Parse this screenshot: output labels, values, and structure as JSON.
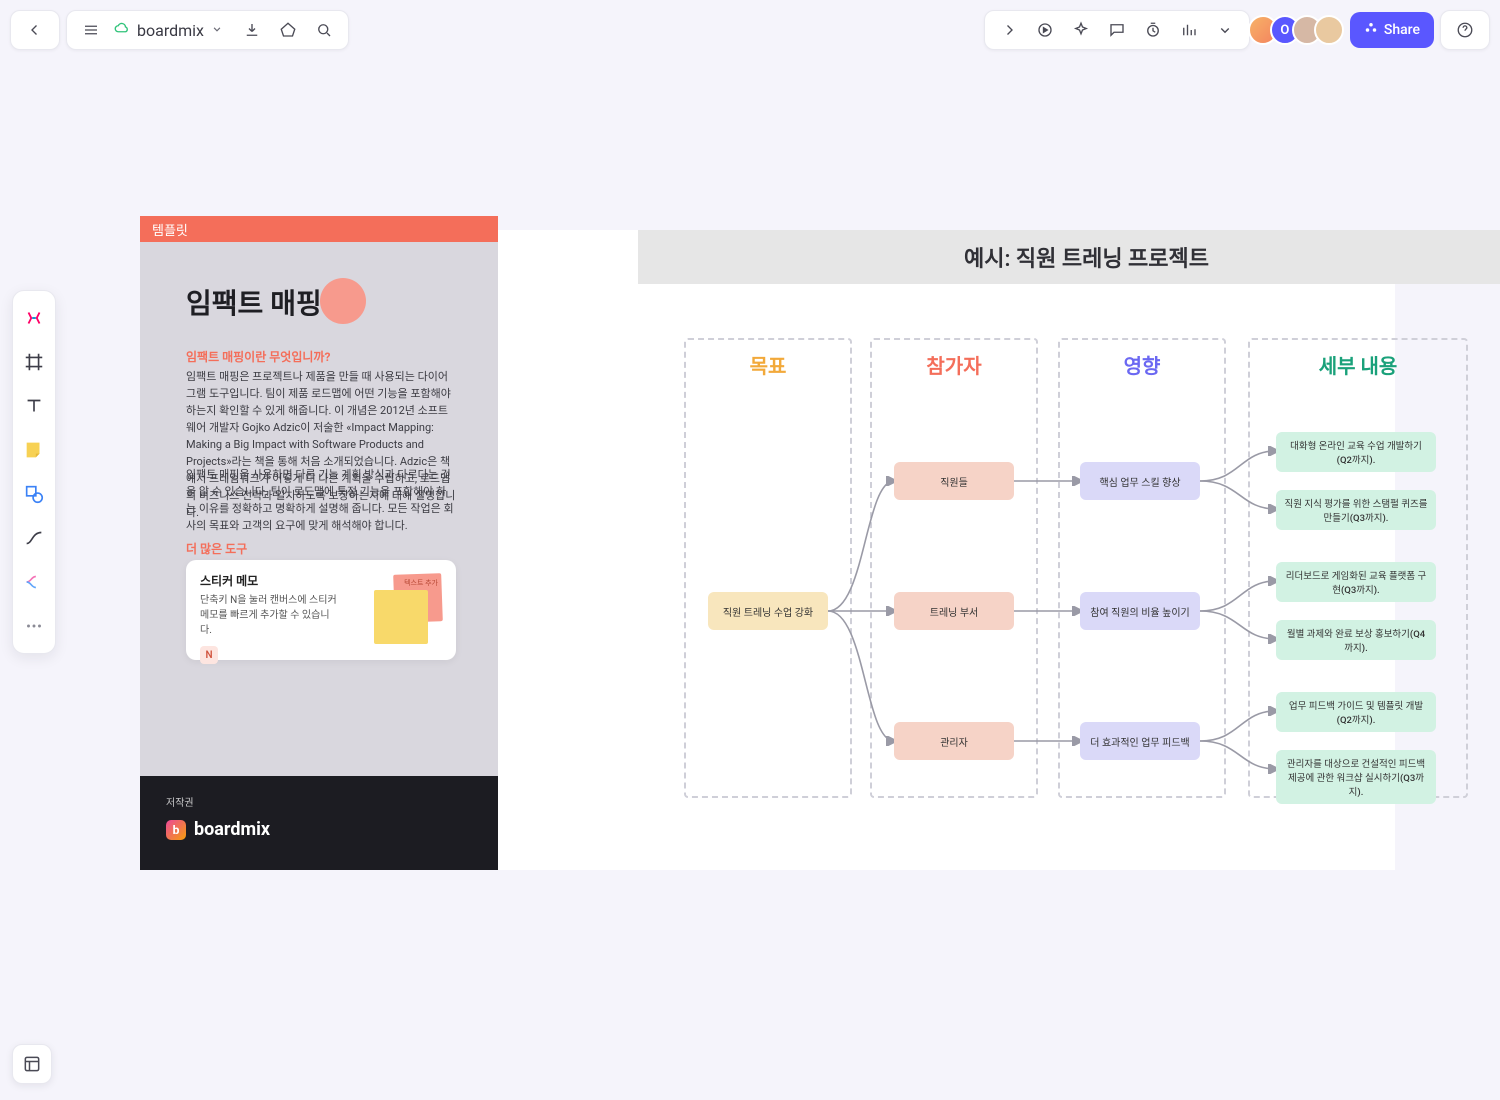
{
  "app": {
    "title": "boardmix"
  },
  "header": {
    "share_label": "Share"
  },
  "example": {
    "title": "예시: 직원 트레닝 프로젝트"
  },
  "sidebar": {
    "tab": "템플릿",
    "heading": "임팩트 매핑",
    "question": "임팩트 매핑이란 무엇입니까?",
    "para1": "임팩트 매핑은 프로젝트나 제품을 만들 때 사용되는 다이어그램 도구입니다. 팀이 제품 로드맵에 어떤 기능을 포함해야 하는지 확인할 수 있게 해줍니다.\n이 개념은 2012년 소프트웨어 개발자 Gojko Adzic이 저술한 «Impact Mapping: Making a Big Impact with Software Products and Projects»라는 책을 통해 처음 소개되었습니다. Adzic은 책에서 프레임워크가 어떻게 더 나은 계획을 수립하고, 로드맵의 비즈니스 전략과 일치하도록 보장하는지에 대해 설명합니다.",
    "para2": "임팩트 매핑을 사용하면 다른 기능 계획 방식과 다르다는 것을 알 수 있습니다. 팀이 로드맵에 특정 기능을 포함해야 하는 이유를 정확하고 명확하게 설명해 줍니다. 모든 작업은 회사의 목표와 고객의 요구에 맞게 해석해야 합니다.",
    "more_tools": "더 많은 도구",
    "toolcard": {
      "title": "스티커 메모",
      "desc": "단축키 N을 눌러 캔버스에 스티커 메모를 빠르게 추가할 수 있습니다.",
      "key": "N",
      "note_hint": "텍스트 추가"
    },
    "footer": {
      "copyright": "저작권",
      "brand": "boardmix"
    }
  },
  "columns": {
    "goal": "목표",
    "actor": "참가자",
    "impact": "영향",
    "deliverable": "세부 내용"
  },
  "nodes": {
    "goal": "직원 트레닝 수업 강화",
    "actors": [
      "직원들",
      "트레닝 부서",
      "관리자"
    ],
    "impacts": [
      "핵심 업무 스킬 향상",
      "참여 직원의 비율 높이기",
      "더 효과적인 업무 피드백"
    ],
    "deliverables": [
      "대화형 온라인 교육 수업 개발하기(Q2까지).",
      "직원 지식 평가를 위한 스탬펄 퀴즈를 만들기(Q3까지).",
      "리더보드로 게임화된 교육 플랫폼 구현(Q3까지).",
      "월별 과제와 완료 보상 홍보하기(Q4까지).",
      "업무 피드백 가이드 및 템플릿 개발(Q2까지).",
      "관리자를 대상으로 건설적인 피드백 제공에 관한 워크샵 실시하기(Q3까지)."
    ]
  }
}
